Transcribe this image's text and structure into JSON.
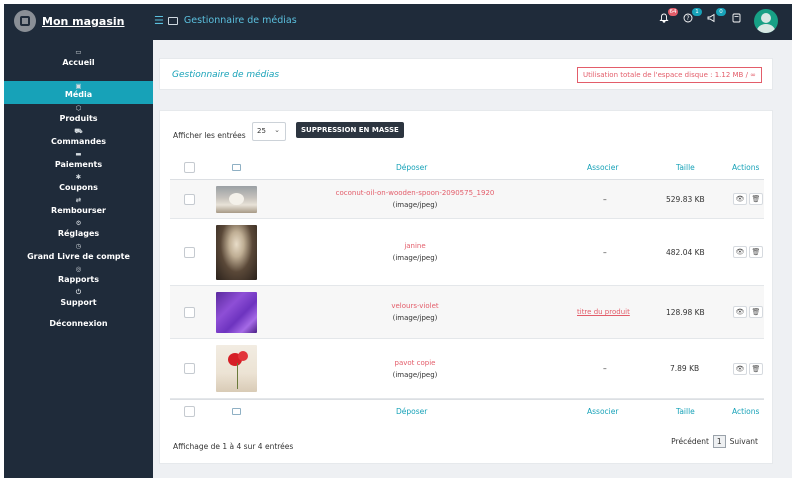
{
  "brand": {
    "name": "Mon magasin"
  },
  "header": {
    "title": "Gestionnaire de médias",
    "badges": {
      "notifications": "64",
      "help": "1",
      "announcements": "0"
    }
  },
  "sidebar": {
    "items": [
      {
        "label": "Accueil",
        "icon": "home-icon"
      },
      {
        "label": "Média",
        "icon": "media-icon",
        "active": true
      },
      {
        "label": "Produits",
        "icon": "box-icon"
      },
      {
        "label": "Commandes",
        "icon": "cart-icon"
      },
      {
        "label": "Paiements",
        "icon": "card-icon"
      },
      {
        "label": "Coupons",
        "icon": "gift-icon"
      },
      {
        "label": "Rembourser",
        "icon": "refresh-icon"
      },
      {
        "label": "Réglages",
        "icon": "gears-icon"
      },
      {
        "label": "Grand Livre de compte",
        "icon": "clock-icon"
      },
      {
        "label": "Rapports",
        "icon": "globe-icon"
      },
      {
        "label": "Support",
        "icon": "power-icon"
      },
      {
        "label": "Déconnexion",
        "icon": ""
      }
    ]
  },
  "page": {
    "title": "Gestionnaire de médias",
    "usage": "Utilisation totale de l'espace disque : 1.12 MB / ∞"
  },
  "table_controls": {
    "length_label": "Afficher les entrées",
    "length_value": "25",
    "bulk_button": "SUPPRESSION EN MASSE"
  },
  "table": {
    "columns": {
      "upload": "Déposer",
      "associate": "Associer",
      "size": "Taille",
      "actions": "Actions"
    },
    "rows": [
      {
        "name": "coconut-oil-on-wooden-spoon-2090575_1920",
        "mime": "(image/jpeg)",
        "associate": "–",
        "size": "529.83 KB"
      },
      {
        "name": "janine",
        "mime": "(image/jpeg)",
        "associate": "–",
        "size": "482.04 KB"
      },
      {
        "name": "velours-violet",
        "mime": "(image/jpeg)",
        "associate": "titre du produit",
        "size": "128.98 KB"
      },
      {
        "name": "pavot copie",
        "mime": "(image/jpeg)",
        "associate": "–",
        "size": "7.89 KB"
      }
    ]
  },
  "footer": {
    "info": "Affichage de 1 à 4 sur 4 entrées",
    "prev": "Précédent",
    "page": "1",
    "next": "Suivant"
  },
  "colors": {
    "accent": "#17a2b8",
    "sidebar": "#1f2b3a",
    "danger": "#e35d6a"
  }
}
